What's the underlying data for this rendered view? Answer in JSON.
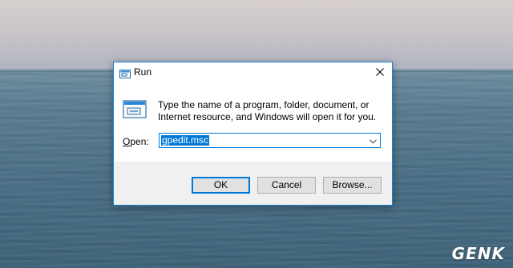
{
  "window": {
    "title": "Run",
    "close_icon": "close-icon",
    "title_icon": "run-icon"
  },
  "content": {
    "icon": "run-program-icon",
    "description": "Type the name of a program, folder, document, or Internet resource, and Windows will open it for you.",
    "open_label_mnemonic": "O",
    "open_label_rest": "pen:",
    "open_value": "gpedit.msc"
  },
  "buttons": {
    "ok": "OK",
    "cancel": "Cancel",
    "browse": "Browse..."
  },
  "watermark": "GENK",
  "colors": {
    "accent": "#0078d7",
    "footer_bg": "#f0f0f0"
  }
}
